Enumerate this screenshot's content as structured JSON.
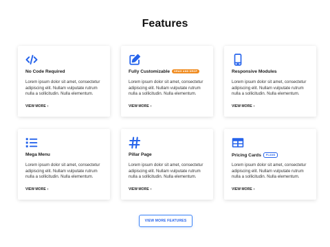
{
  "page": {
    "title": "Features",
    "accent_color": "#2563eb",
    "badge_color": "#f08b1f"
  },
  "cards": [
    {
      "icon": "code-icon",
      "name": "No Code Required",
      "badge": "",
      "description": "Lorem ipsum dolor sit amet, consectetur adipiscing elit. Nullam vulputate rutrum nulla a sollicitudin. Nulla elementum.",
      "link": "VIEW MORE"
    },
    {
      "icon": "edit-icon",
      "name": "Fully Customizable",
      "badge": "DRAG AND DROP",
      "description": "Lorem ipsum dolor sit amet, consectetur adipiscing elit. Nullam vulputate rutrum nulla a sollicitudin. Nulla elementum.",
      "link": "VIEW MORE"
    },
    {
      "icon": "mobile-icon",
      "name": "Responsive Modules",
      "badge": "",
      "description": "Lorem ipsum dolor sit amet, consectetur adipiscing elit. Nullam vulputate rutrum nulla a sollicitudin. Nulla elementum.",
      "link": "VIEW MORE"
    },
    {
      "icon": "list-icon",
      "name": "Mega Menu",
      "badge": "",
      "description": "Lorem ipsum dolor sit amet, consectetur adipiscing elit. Nullam vulputate rutrum nulla a sollicitudin. Nulla elementum.",
      "link": "VIEW MORE"
    },
    {
      "icon": "hashtag-icon",
      "name": "Pillar Page",
      "badge": "",
      "description": "Lorem ipsum dolor sit amet, consectetur adipiscing elit. Nullam vulputate rutrum nulla a sollicitudin. Nulla elementum.",
      "link": "VIEW MORE"
    },
    {
      "icon": "table-icon",
      "name": "Pricing Cards",
      "badge": "PLANS",
      "description": "Lorem ipsum dolor sit amet, consectetur adipiscing elit. Nullam vulputate rutrum nulla a sollicitudin. Nulla elementum.",
      "link": "VIEW MORE"
    }
  ],
  "cta": {
    "label": "VIEW MORE FEATURES"
  }
}
